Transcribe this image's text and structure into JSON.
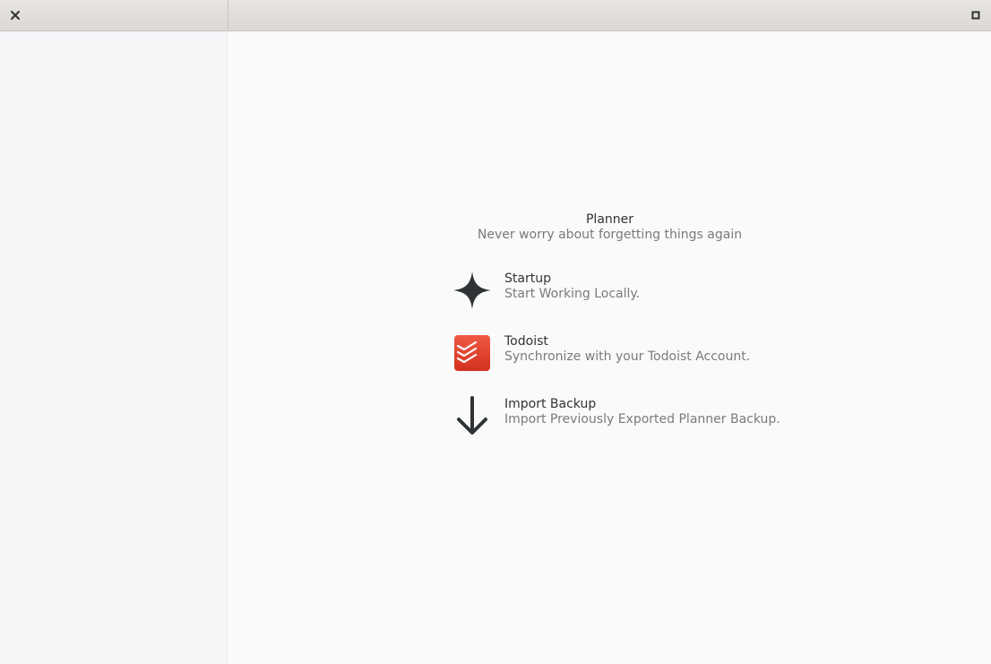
{
  "window": {
    "close_icon": "close-icon",
    "maximize_icon": "maximize-icon"
  },
  "welcome": {
    "title": "Planner",
    "subtitle": "Never worry about forgetting things again"
  },
  "options": [
    {
      "label": "Startup",
      "description": "Start Working Locally.",
      "icon": "sparkle-icon",
      "icon_color": "#2e3436"
    },
    {
      "label": "Todoist",
      "description": "Synchronize with your Todoist Account.",
      "icon": "todoist-icon",
      "icon_color": "#e44332"
    },
    {
      "label": "Import Backup",
      "description": "Import Previously Exported Planner Backup.",
      "icon": "arrow-down-icon",
      "icon_color": "#2e3436"
    }
  ]
}
